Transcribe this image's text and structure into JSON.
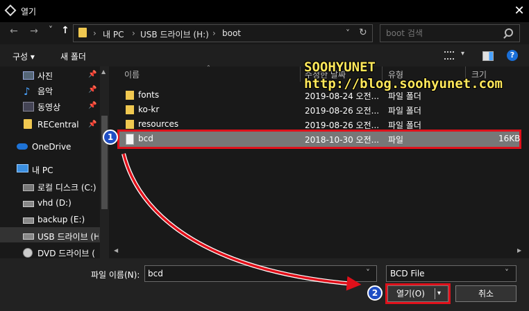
{
  "window": {
    "title": "열기",
    "close_glyph": "✕"
  },
  "nav": {
    "back": "←",
    "forward": "→",
    "recent": "˅",
    "up": "↑",
    "refresh": "↻"
  },
  "address": {
    "sep": "›",
    "crumbs": [
      "내 PC",
      "USB 드라이브 (H:)",
      "boot"
    ],
    "dropdown": "˅"
  },
  "search": {
    "placeholder": "boot 검색"
  },
  "commands": {
    "organize": "구성 ▾",
    "new_folder": "새 폴더",
    "help": "?"
  },
  "sidebar": {
    "items": [
      {
        "label": "사진",
        "pinned": true
      },
      {
        "label": "음악",
        "pinned": true
      },
      {
        "label": "동영상",
        "pinned": true
      },
      {
        "label": "RECentral",
        "pinned": true
      },
      {
        "label": "OneDrive"
      },
      {
        "label": "내 PC"
      },
      {
        "label": "로컬 디스크 (C:)"
      },
      {
        "label": "vhd (D:)"
      },
      {
        "label": "backup (E:)"
      },
      {
        "label": "USB 드라이브 (H"
      },
      {
        "label": "DVD 드라이브 ("
      }
    ]
  },
  "columns": {
    "name": "이름",
    "date": "수정한 날짜",
    "type": "유형",
    "size": "크기"
  },
  "files": [
    {
      "name": "fonts",
      "date": "2019-08-24 오전...",
      "type": "파일 폴더",
      "size": ""
    },
    {
      "name": "ko-kr",
      "date": "2019-08-26 오전...",
      "type": "파일 폴더",
      "size": ""
    },
    {
      "name": "resources",
      "date": "2019-08-26 오전...",
      "type": "파일 폴더",
      "size": ""
    },
    {
      "name": "bcd",
      "date": "2018-10-30 오전...",
      "type": "파일",
      "size": "16KB"
    }
  ],
  "filename": {
    "label": "파일 이름(N):",
    "value": "bcd",
    "dropdown": "˅"
  },
  "filetype": {
    "value": "BCD File",
    "dropdown": "˅"
  },
  "buttons": {
    "open": "열기(O)",
    "open_arrow": "▾",
    "cancel": "취소"
  },
  "annotations": {
    "badge1": "1",
    "badge2": "2",
    "wm_line1": "SOOHYUNET",
    "wm_line2": "http://blog.soohyunet.com"
  },
  "colors": {
    "highlight": "#e0101a",
    "selection": "#777777",
    "badge": "#1f4ec4",
    "watermark": "#ffe85a"
  }
}
